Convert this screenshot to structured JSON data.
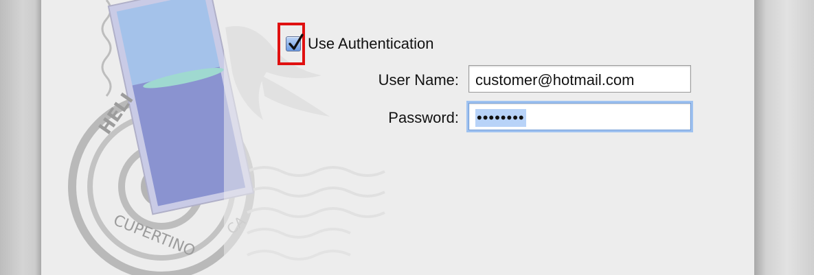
{
  "auth": {
    "use_authentication_label": "Use Authentication",
    "use_authentication_checked": true,
    "username_label": "User Name:",
    "username_value": "customer@hotmail.com",
    "password_label": "Password:",
    "password_masked": "••••••••"
  },
  "stamp": {
    "text_top": "HELI",
    "text_bottom": "CUPERTINO",
    "text_state": "CA"
  },
  "colors": {
    "highlight_box": "#e01010",
    "focus_ring": "#9fc2f0",
    "checkbox_fill": "#6c9be4"
  },
  "icons": {
    "checkbox": "checkmark-icon",
    "background_art": "mail-stamp-eagle-icon"
  }
}
